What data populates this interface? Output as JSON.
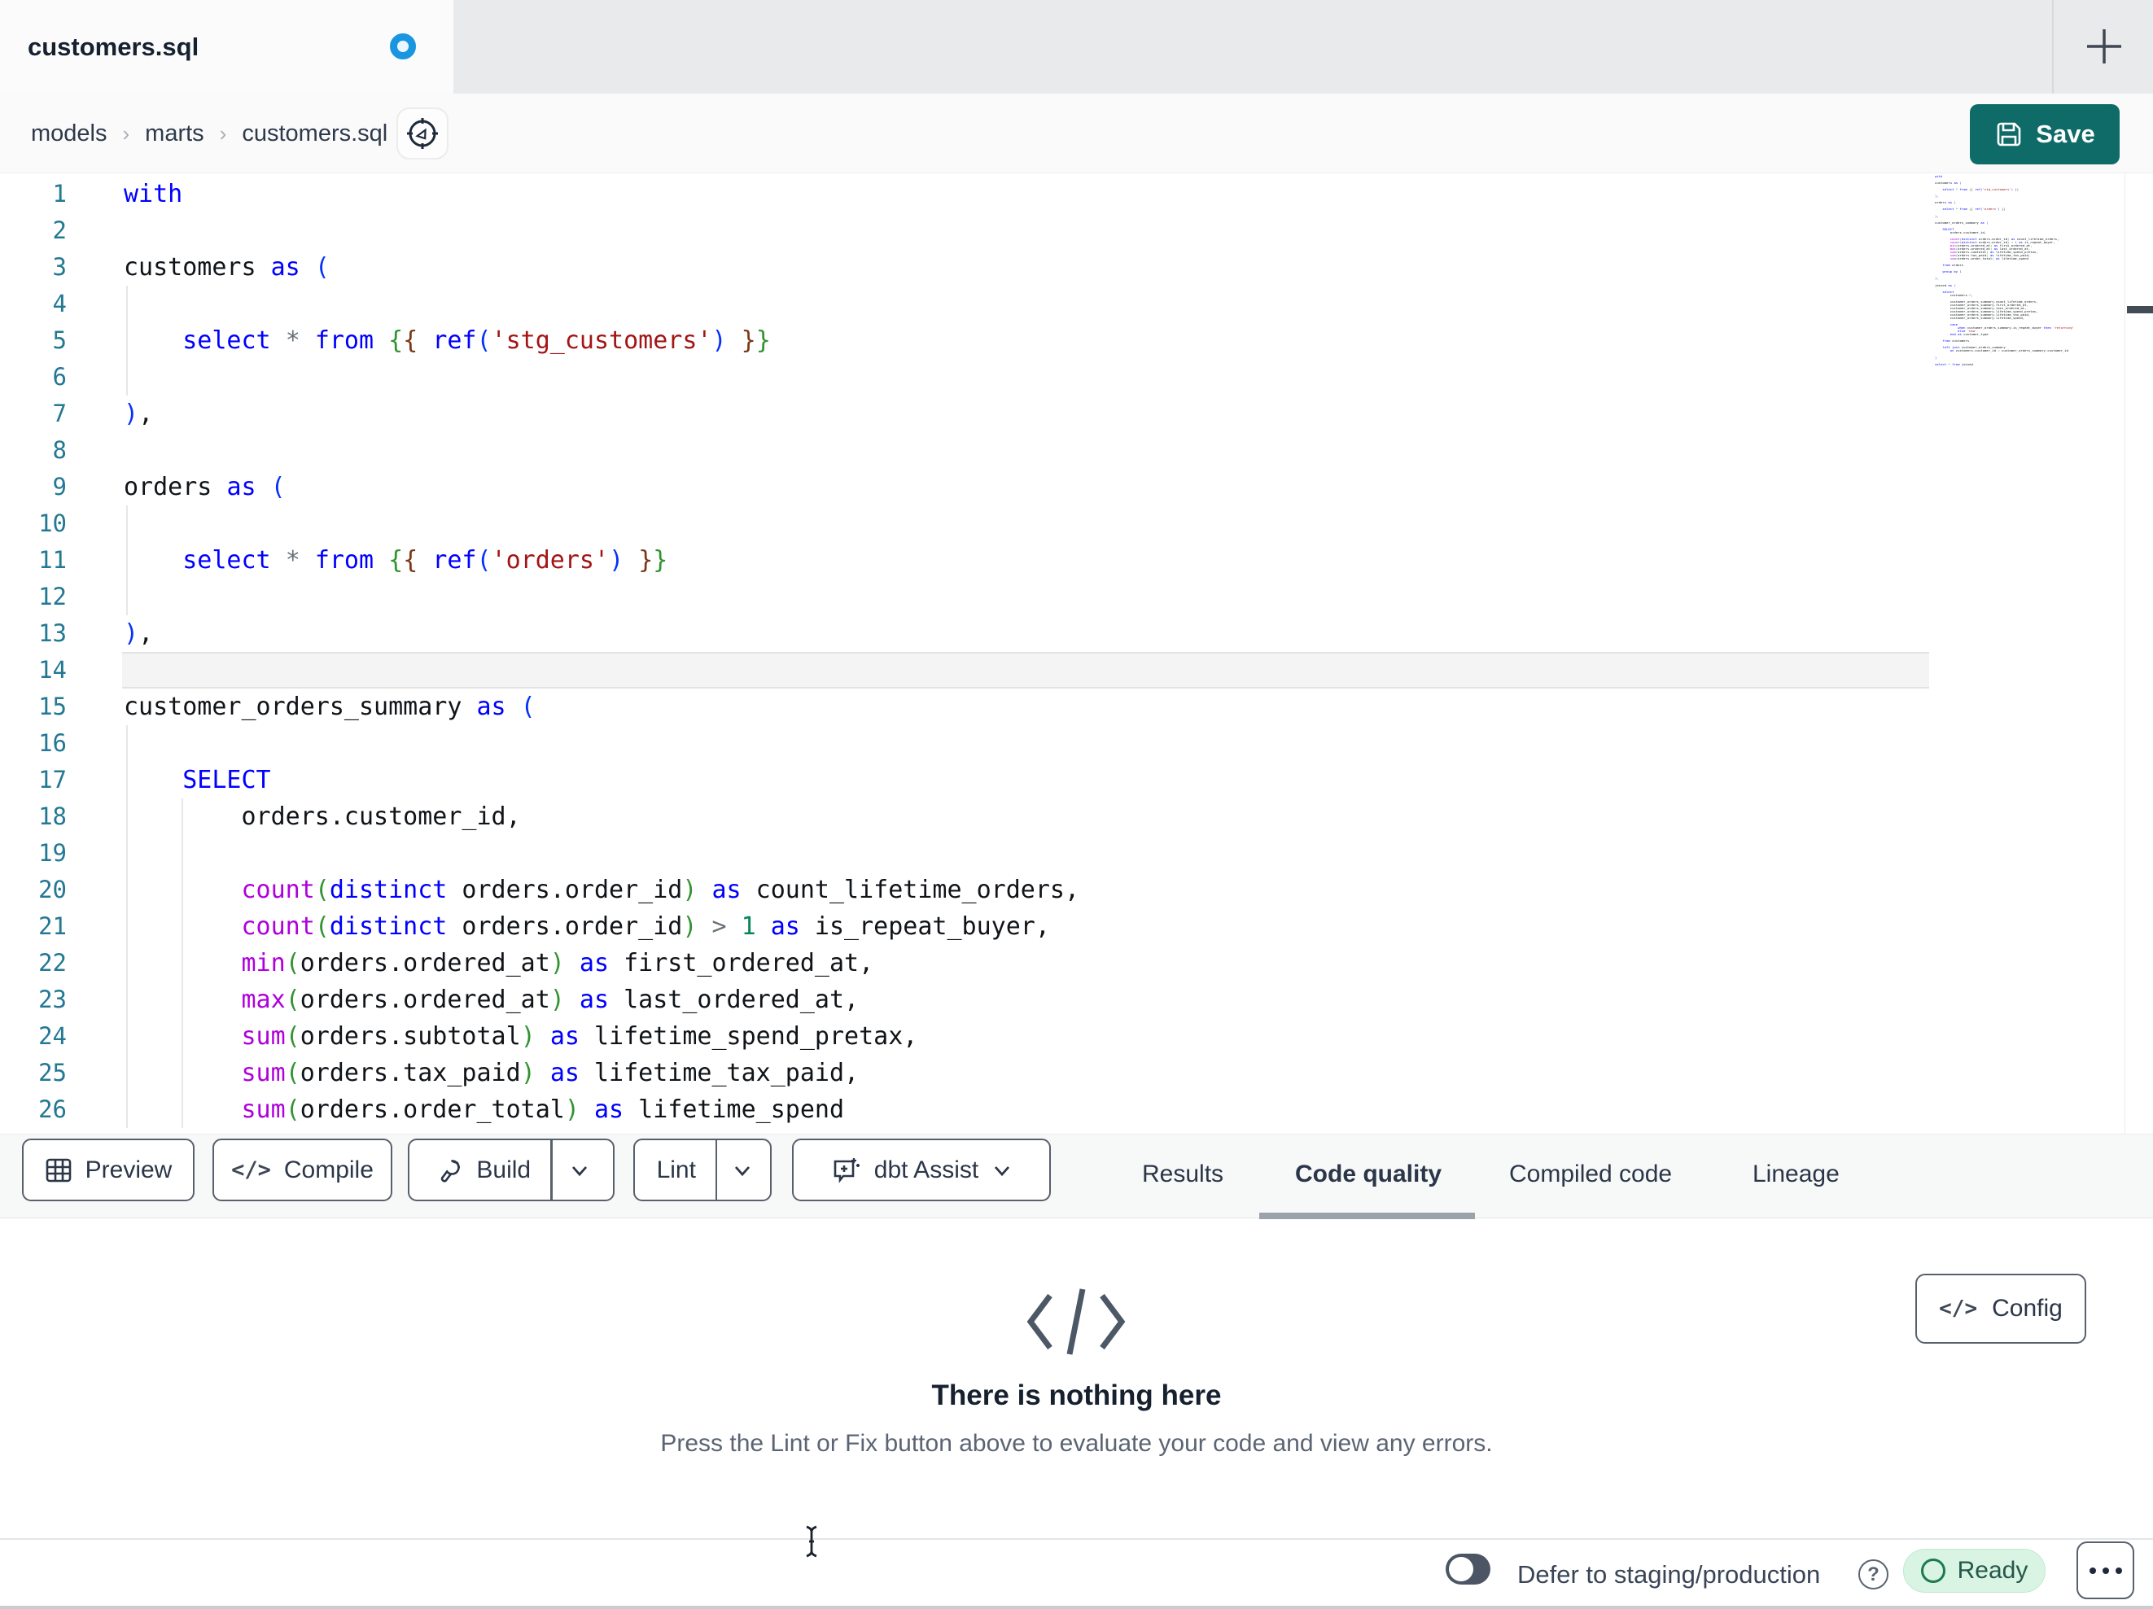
{
  "tab_bar": {
    "active_tab": "customers.sql",
    "unsaved_dot_color": "#1a96e0"
  },
  "breadcrumb": {
    "items": [
      "models",
      "marts",
      "customers.sql"
    ],
    "separator": "›"
  },
  "save_button": {
    "label": "Save"
  },
  "editor": {
    "current_line": 14,
    "lines": [
      [
        [
          "k",
          "with"
        ]
      ],
      [],
      [
        [
          "id",
          "customers "
        ],
        [
          "k",
          "as"
        ],
        [
          "id",
          " "
        ],
        [
          "b1",
          "("
        ]
      ],
      [],
      [
        [
          "id",
          "    "
        ],
        [
          "k",
          "select"
        ],
        [
          "id",
          " "
        ],
        [
          "op",
          "*"
        ],
        [
          "id",
          " "
        ],
        [
          "k",
          "from"
        ],
        [
          "id",
          " "
        ],
        [
          "b2",
          "{"
        ],
        [
          "b3",
          "{"
        ],
        [
          "id",
          " "
        ],
        [
          "k",
          "ref"
        ],
        [
          "b1",
          "("
        ],
        [
          "str",
          "'stg_customers'"
        ],
        [
          "b1",
          ")"
        ],
        [
          "id",
          " "
        ],
        [
          "b3",
          "}"
        ],
        [
          "b2",
          "}"
        ]
      ],
      [],
      [
        [
          "b1",
          ")"
        ],
        [
          "id",
          ","
        ]
      ],
      [],
      [
        [
          "id",
          "orders "
        ],
        [
          "k",
          "as"
        ],
        [
          "id",
          " "
        ],
        [
          "b1",
          "("
        ]
      ],
      [],
      [
        [
          "id",
          "    "
        ],
        [
          "k",
          "select"
        ],
        [
          "id",
          " "
        ],
        [
          "op",
          "*"
        ],
        [
          "id",
          " "
        ],
        [
          "k",
          "from"
        ],
        [
          "id",
          " "
        ],
        [
          "b2",
          "{"
        ],
        [
          "b3",
          "{"
        ],
        [
          "id",
          " "
        ],
        [
          "k",
          "ref"
        ],
        [
          "b1",
          "("
        ],
        [
          "str",
          "'orders'"
        ],
        [
          "b1",
          ")"
        ],
        [
          "id",
          " "
        ],
        [
          "b3",
          "}"
        ],
        [
          "b2",
          "}"
        ]
      ],
      [],
      [
        [
          "b1",
          ")"
        ],
        [
          "id",
          ","
        ]
      ],
      [],
      [
        [
          "id",
          "customer_orders_summary "
        ],
        [
          "k",
          "as"
        ],
        [
          "id",
          " "
        ],
        [
          "b1",
          "("
        ]
      ],
      [],
      [
        [
          "id",
          "    "
        ],
        [
          "k",
          "SELECT"
        ]
      ],
      [
        [
          "id",
          "        orders.customer_id,"
        ]
      ],
      [],
      [
        [
          "id",
          "        "
        ],
        [
          "fn",
          "count"
        ],
        [
          "b2",
          "("
        ],
        [
          "k",
          "distinct"
        ],
        [
          "id",
          " orders.order_id"
        ],
        [
          "b2",
          ")"
        ],
        [
          "id",
          " "
        ],
        [
          "k",
          "as"
        ],
        [
          "id",
          " count_lifetime_orders,"
        ]
      ],
      [
        [
          "id",
          "        "
        ],
        [
          "fn",
          "count"
        ],
        [
          "b2",
          "("
        ],
        [
          "k",
          "distinct"
        ],
        [
          "id",
          " orders.order_id"
        ],
        [
          "b2",
          ")"
        ],
        [
          "id",
          " "
        ],
        [
          "op",
          ">"
        ],
        [
          "id",
          " "
        ],
        [
          "num",
          "1"
        ],
        [
          "id",
          " "
        ],
        [
          "k",
          "as"
        ],
        [
          "id",
          " is_repeat_buyer,"
        ]
      ],
      [
        [
          "id",
          "        "
        ],
        [
          "fn",
          "min"
        ],
        [
          "b2",
          "("
        ],
        [
          "id",
          "orders.ordered_at"
        ],
        [
          "b2",
          ")"
        ],
        [
          "id",
          " "
        ],
        [
          "k",
          "as"
        ],
        [
          "id",
          " first_ordered_at,"
        ]
      ],
      [
        [
          "id",
          "        "
        ],
        [
          "fn",
          "max"
        ],
        [
          "b2",
          "("
        ],
        [
          "id",
          "orders.ordered_at"
        ],
        [
          "b2",
          ")"
        ],
        [
          "id",
          " "
        ],
        [
          "k",
          "as"
        ],
        [
          "id",
          " last_ordered_at,"
        ]
      ],
      [
        [
          "id",
          "        "
        ],
        [
          "fn",
          "sum"
        ],
        [
          "b2",
          "("
        ],
        [
          "id",
          "orders.subtotal"
        ],
        [
          "b2",
          ")"
        ],
        [
          "id",
          " "
        ],
        [
          "k",
          "as"
        ],
        [
          "id",
          " lifetime_spend_pretax,"
        ]
      ],
      [
        [
          "id",
          "        "
        ],
        [
          "fn",
          "sum"
        ],
        [
          "b2",
          "("
        ],
        [
          "id",
          "orders.tax_paid"
        ],
        [
          "b2",
          ")"
        ],
        [
          "id",
          " "
        ],
        [
          "k",
          "as"
        ],
        [
          "id",
          " lifetime_tax_paid,"
        ]
      ],
      [
        [
          "id",
          "        "
        ],
        [
          "fn",
          "sum"
        ],
        [
          "b2",
          "("
        ],
        [
          "id",
          "orders.order_total"
        ],
        [
          "b2",
          ")"
        ],
        [
          "id",
          " "
        ],
        [
          "k",
          "as"
        ],
        [
          "id",
          " lifetime_spend"
        ]
      ]
    ]
  },
  "minimap": {
    "extra_lines": [
      [],
      [
        [
          "id",
          "    "
        ],
        [
          "k",
          "from"
        ],
        [
          "id",
          " orders"
        ]
      ],
      [],
      [
        [
          "id",
          "    "
        ],
        [
          "k",
          "group by"
        ],
        [
          "id",
          " "
        ],
        [
          "num",
          "1"
        ]
      ],
      [],
      [
        [
          "b1",
          ")"
        ],
        [
          "id",
          ","
        ]
      ],
      [],
      [
        [
          "id",
          "joined "
        ],
        [
          "k",
          "as"
        ],
        [
          "id",
          " "
        ],
        [
          "b1",
          "("
        ]
      ],
      [],
      [
        [
          "id",
          "    "
        ],
        [
          "k",
          "select"
        ]
      ],
      [
        [
          "id",
          "        customers."
        ],
        [
          "op",
          "*"
        ],
        [
          "id",
          ","
        ]
      ],
      [],
      [
        [
          "id",
          "        customer_orders_summary.count_lifetime_orders,"
        ]
      ],
      [
        [
          "id",
          "        customer_orders_summary.first_ordered_at,"
        ]
      ],
      [
        [
          "id",
          "        customer_orders_summary.last_ordered_at,"
        ]
      ],
      [
        [
          "id",
          "        customer_orders_summary.lifetime_spend_pretax,"
        ]
      ],
      [
        [
          "id",
          "        customer_orders_summary.lifetime_tax_paid,"
        ]
      ],
      [
        [
          "id",
          "        customer_orders_summary.lifetime_spend,"
        ]
      ],
      [],
      [
        [
          "id",
          "        "
        ],
        [
          "k",
          "case"
        ]
      ],
      [
        [
          "id",
          "            "
        ],
        [
          "k",
          "when"
        ],
        [
          "id",
          " customer_orders_summary.is_repeat_buyer "
        ],
        [
          "k",
          "then"
        ],
        [
          "id",
          " "
        ],
        [
          "str",
          "'returning'"
        ]
      ],
      [
        [
          "id",
          "            "
        ],
        [
          "k",
          "else"
        ],
        [
          "id",
          " "
        ],
        [
          "str",
          "'new'"
        ]
      ],
      [
        [
          "id",
          "        "
        ],
        [
          "k",
          "end"
        ],
        [
          "id",
          " "
        ],
        [
          "k",
          "as"
        ],
        [
          "id",
          " customer_type"
        ]
      ],
      [],
      [
        [
          "id",
          "    "
        ],
        [
          "k",
          "from"
        ],
        [
          "id",
          " customers"
        ]
      ],
      [],
      [
        [
          "id",
          "    "
        ],
        [
          "k",
          "left join"
        ],
        [
          "id",
          " customer_orders_summary"
        ]
      ],
      [
        [
          "id",
          "        "
        ],
        [
          "k",
          "on"
        ],
        [
          "id",
          " customers.customer_id "
        ],
        [
          "op",
          "="
        ],
        [
          "id",
          " customer_orders_summary.customer_id"
        ]
      ],
      [],
      [
        [
          "b1",
          ")"
        ]
      ],
      [],
      [
        [
          "k",
          "select"
        ],
        [
          "id",
          " "
        ],
        [
          "op",
          "*"
        ],
        [
          "id",
          " "
        ],
        [
          "k",
          "from"
        ],
        [
          "id",
          " joined"
        ]
      ]
    ]
  },
  "syntax_colors": {
    "k": "#0000ff",
    "fn": "#af00db",
    "str": "#a31515",
    "num": "#098658",
    "op": "#687078",
    "id": "#101418",
    "b1": "#0431fa",
    "b2": "#319331",
    "b3": "#7b3814",
    "ln": "#237893"
  },
  "toolbar": {
    "preview_label": "Preview",
    "compile_label": "Compile",
    "build_label": "Build",
    "lint_label": "Lint",
    "assist_label": "dbt Assist"
  },
  "panel_tabs": [
    {
      "label": "Results",
      "active": false
    },
    {
      "label": "Code quality",
      "active": true
    },
    {
      "label": "Compiled code",
      "active": false
    },
    {
      "label": "Lineage",
      "active": false
    }
  ],
  "results_panel": {
    "empty_title": "There is nothing here",
    "empty_subtitle": "Press the Lint or Fix button above to evaluate your code and view any errors.",
    "config_label": "Config",
    "code_glyph": "</>"
  },
  "status_bar": {
    "defer_label": "Defer to staging/production",
    "ready_label": "Ready",
    "toggle_on": false,
    "help_glyph": "?"
  }
}
